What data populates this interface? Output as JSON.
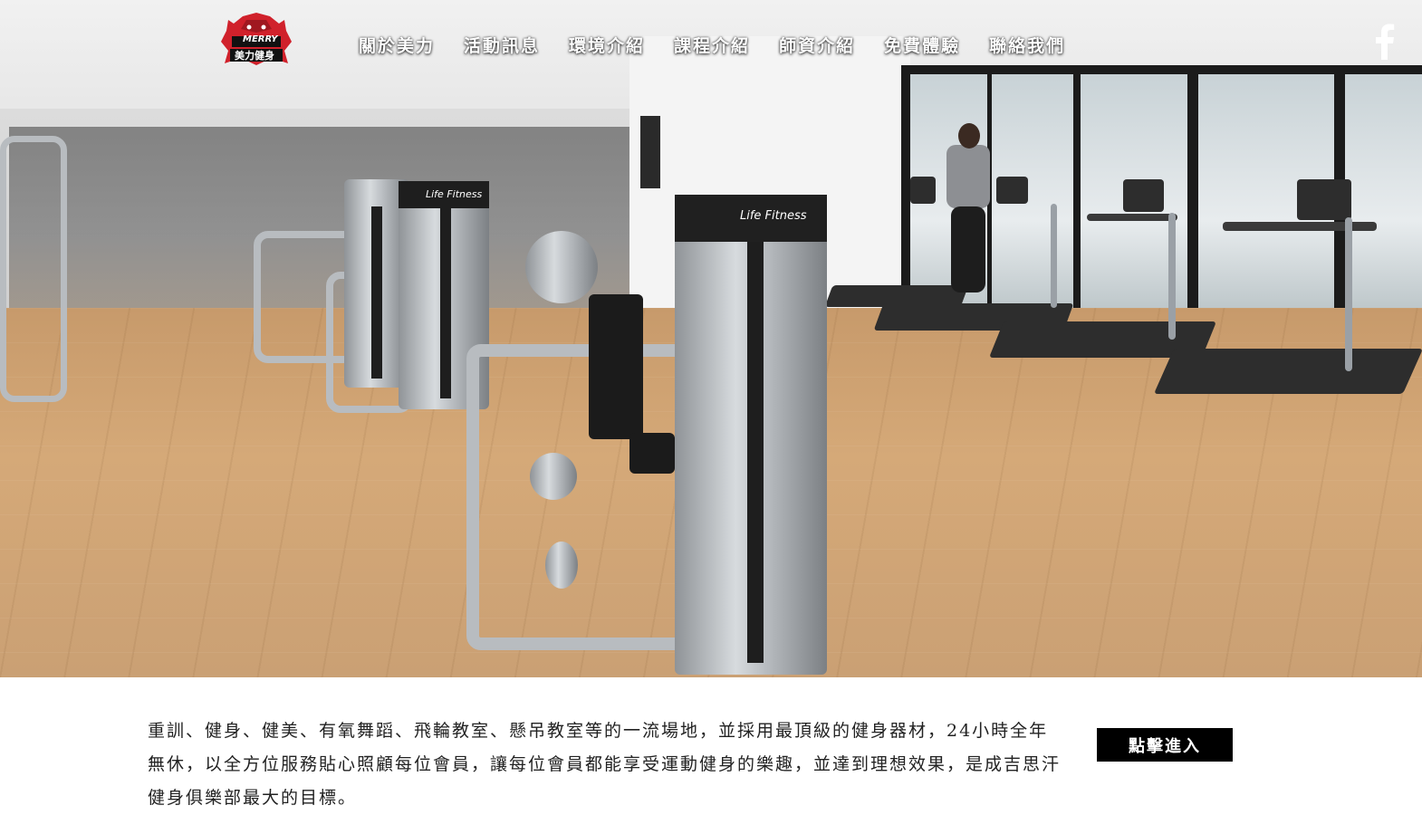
{
  "header": {
    "logo": {
      "text_top": "MERRY",
      "text_bottom": "美力健身",
      "icon": "red-bear-icon"
    },
    "nav": [
      {
        "label": "關於美力"
      },
      {
        "label": "活動訊息"
      },
      {
        "label": "環境介紹"
      },
      {
        "label": "課程介紹"
      },
      {
        "label": "師資介紹"
      },
      {
        "label": "免費體驗"
      },
      {
        "label": "聯絡我們"
      }
    ],
    "social": {
      "icon": "facebook-icon",
      "glyph": "f"
    }
  },
  "hero": {
    "image": "gym-interior-photo",
    "machine_brand": "Life Fitness"
  },
  "intro": {
    "text": "重訓、健身、健美、有氧舞蹈、飛輪教室、懸吊教室等的一流場地，並採用最頂級的健身器材，24小時全年無休，以全方位服務貼心照顧每位會員，讓每位會員都能享受運動健身的樂趣，並達到理想效果，是成吉思汗健身俱樂部最大的目標。"
  },
  "cta": {
    "label": "點擊進入"
  },
  "colors": {
    "logo_red": "#d0212b",
    "cta_bg": "#000000",
    "nav_text": "#ffffff"
  }
}
